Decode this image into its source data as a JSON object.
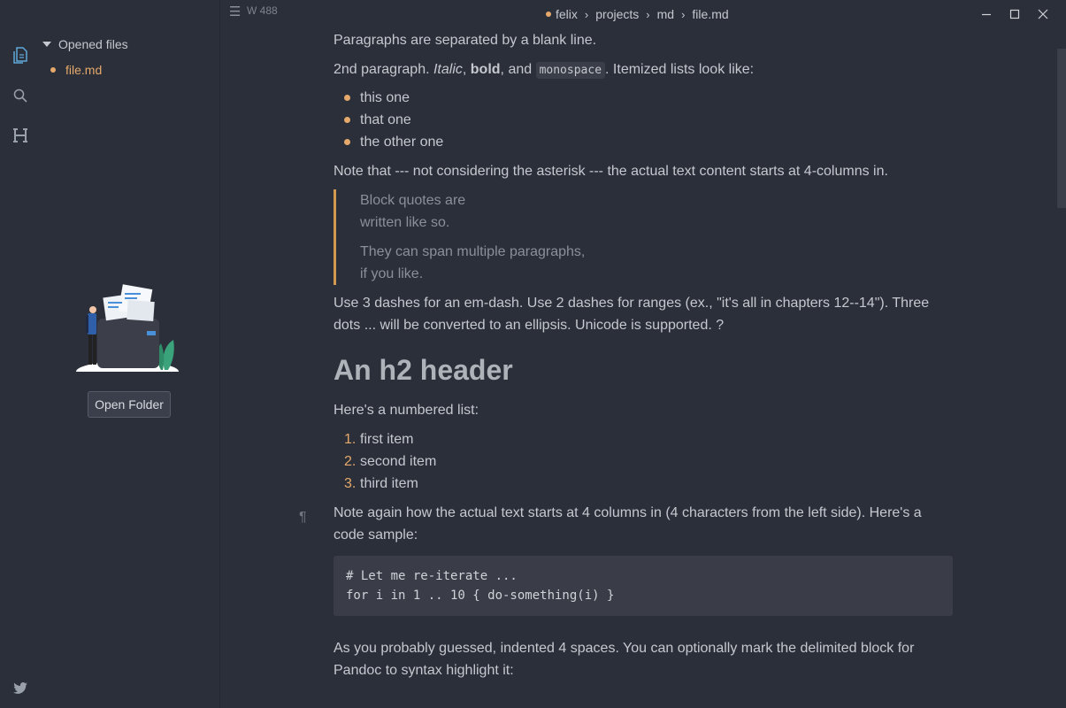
{
  "sidebar": {
    "opened_files_label": "Opened files",
    "files": [
      "file.md"
    ],
    "open_folder_label": "Open Folder"
  },
  "titlebar": {
    "word_count": "W 488",
    "breadcrumbs": [
      "felix",
      "projects",
      "md",
      "file.md"
    ]
  },
  "doc": {
    "p1": "Paragraphs are separated by a blank line.",
    "p2": {
      "start": "2nd paragraph. ",
      "italic": "Italic",
      "sep1": ", ",
      "bold": "bold",
      "sep2": ", and ",
      "mono": "monospace",
      "end": ". Itemized lists look like:"
    },
    "bullets": [
      "this one",
      "that one",
      "the other one"
    ],
    "p3": "Note that --- not considering the asterisk --- the actual text content starts at 4-columns in.",
    "quote1": [
      "Block quotes are",
      "written like so."
    ],
    "quote2": [
      "They can span multiple paragraphs,",
      "if you like."
    ],
    "p4_line1": "Use 3 dashes for an em-dash. Use 2 dashes for ranges (ex., \"it's all in chapters 12--14\"). Three",
    "p4_line2": "dots ... will be converted to an ellipsis. Unicode is supported. ?",
    "h2": "An h2 header",
    "p5": "Here's a numbered list:",
    "numbered": [
      {
        "num": "1.",
        "text": "first item"
      },
      {
        "num": "2.",
        "text": "second item"
      },
      {
        "num": "3.",
        "text": "third item"
      }
    ],
    "p6_line1": "Note again how the actual text starts at 4 columns in (4 characters from the left side). Here's a",
    "p6_line2": "code sample:",
    "code_lines": [
      "# Let me re-iterate ...",
      "for i in 1 .. 10 { do-something(i) }"
    ],
    "p7_line1": "As you probably guessed, indented 4 spaces. You can optionally mark the delimited block for",
    "p7_line2": "Pandoc to syntax highlight it:",
    "pilcrow": "¶"
  },
  "colors": {
    "accent": "#e5a96b",
    "background": "#2b2f39",
    "quote_border": "#d39a4f"
  },
  "icons": [
    "files-icon",
    "search-icon",
    "heading-icon",
    "twitter-icon",
    "menu-icon",
    "minimize-icon",
    "maximize-icon",
    "close-icon"
  ]
}
